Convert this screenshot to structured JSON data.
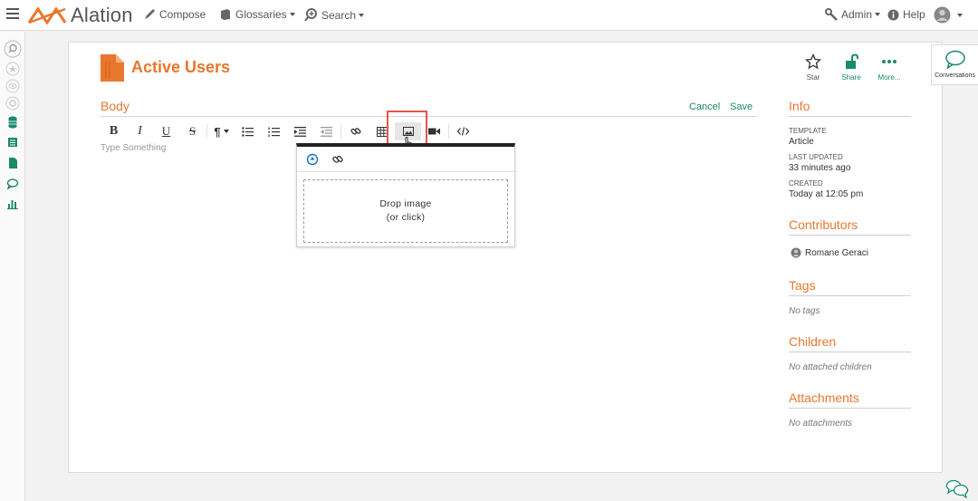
{
  "topbar": {
    "logo_text": "Alation",
    "compose": "Compose",
    "glossaries": "Glossaries",
    "search": "Search",
    "admin": "Admin",
    "help": "Help"
  },
  "article": {
    "title": "Active Users",
    "actions": {
      "star": "Star",
      "share": "Share",
      "more": "More..."
    }
  },
  "editor": {
    "body_label": "Body",
    "cancel": "Cancel",
    "save": "Save",
    "placeholder": "Type Something",
    "toolbar": {
      "bold": "B",
      "italic": "I",
      "underline": "U",
      "strike": "S",
      "paragraph": "¶"
    },
    "image_popover": {
      "drop_line1": "Drop image",
      "drop_line2": "(or click)"
    }
  },
  "info": {
    "title": "Info",
    "template_label": "TEMPLATE",
    "template_value": "Article",
    "updated_label": "LAST UPDATED",
    "updated_value": "33 minutes ago",
    "created_label": "CREATED",
    "created_value": "Today at 12:05 pm"
  },
  "contributors": {
    "title": "Contributors",
    "name": "Romane Geraci"
  },
  "tags": {
    "title": "Tags",
    "empty": "No tags"
  },
  "children": {
    "title": "Children",
    "empty": "No attached children"
  },
  "attachments": {
    "title": "Attachments",
    "empty": "No attachments"
  },
  "conversations": {
    "label": "Conversations"
  },
  "colors": {
    "accent": "#e8772e",
    "green": "#1b8a6b",
    "highlight": "#e8544a"
  }
}
